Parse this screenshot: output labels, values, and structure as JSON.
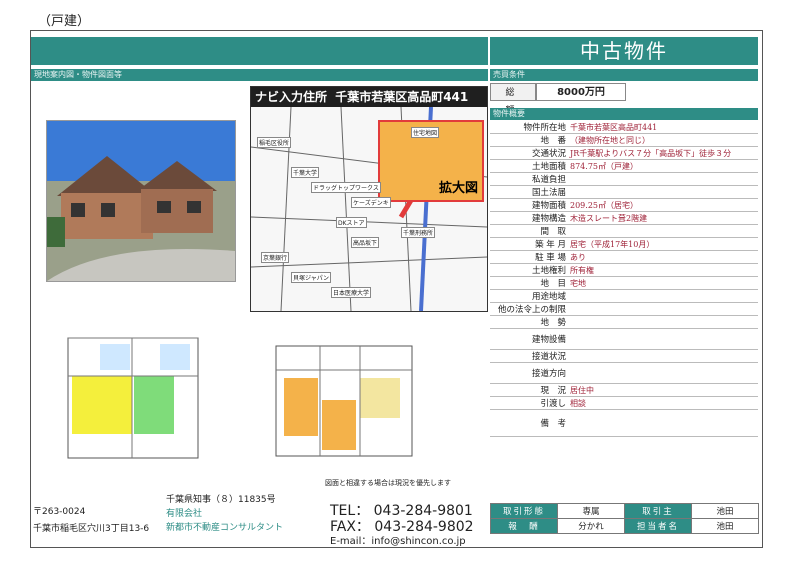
{
  "header": {
    "type_label": "（戸建）",
    "category_title": "中古物件",
    "left_section_label": "現地案内図・物件図面等",
    "sale_terms_label": "売買条件",
    "overview_label": "物件概要"
  },
  "price": {
    "label": "総　額",
    "value": "8000万円"
  },
  "details": [
    {
      "key": "物件所在地",
      "value": "千葉市若葉区高品町441"
    },
    {
      "key": "地　番",
      "value": "（建物所在地と同じ）"
    },
    {
      "key": "交通状況",
      "value": "JR千葉駅よりバス７分「高品坂下」徒歩３分"
    },
    {
      "key": "土地面積",
      "value": "874.75㎡（戸建）"
    },
    {
      "key": "私道負担",
      "value": ""
    },
    {
      "key": "国土法届",
      "value": ""
    },
    {
      "key": "建物面積",
      "value": "209.25㎡（居宅）"
    },
    {
      "key": "建物構造",
      "value": "木造スレート葺2階建"
    },
    {
      "key": "間　取",
      "value": ""
    },
    {
      "key": "築 年 月",
      "value": "居宅（平成17年10月）"
    },
    {
      "key": "駐 車 場",
      "value": "あり"
    },
    {
      "key": "土地権利",
      "value": "所有権"
    },
    {
      "key": "地　目",
      "value": "宅地"
    },
    {
      "key": "用途地域",
      "value": ""
    },
    {
      "key": "他の法令上の制限",
      "value": ""
    },
    {
      "key": "地　勢",
      "value": ""
    },
    {
      "key": "建物設備",
      "value": ""
    },
    {
      "key": "接道状況",
      "value": ""
    },
    {
      "key": "接道方向",
      "value": ""
    },
    {
      "key": "現　況",
      "value": "居住中"
    },
    {
      "key": "引渡し",
      "value": "相談"
    },
    {
      "key": "備　考",
      "value": ""
    }
  ],
  "map": {
    "header_prefix": "ナビ入力住所",
    "header_address": "千葉市若葉区高品町441",
    "zoom_label": "拡大図",
    "labels": [
      "稲毛区役所",
      "千葉大学",
      "ドラッグトップワークス",
      "ケーズデンキ",
      "DKストア",
      "千葉刑務所",
      "京葉銀行",
      "高品坂下",
      "住宅地図",
      "貝塚ジャパン",
      "日本医療大学"
    ]
  },
  "note": "図面と相違する場合は現況を優先します",
  "footer": {
    "postal": "〒263-0024",
    "address": "千葉市稲毛区穴川3丁目13-6",
    "license": "千葉県知事（８）11835号",
    "company_type": "有限会社",
    "company_name": "新都市不動産コンサルタント",
    "tel": "TEL： 043-284-9801",
    "fax": "FAX： 043-284-9802",
    "email": "E-mail：info@shincon.co.jp",
    "terms": [
      {
        "label": "取引形態",
        "value": "専属",
        "label2": "取引主",
        "value2": "池田"
      },
      {
        "label": "報　酬",
        "value": "分かれ",
        "label2": "担当者名",
        "value2": "池田"
      }
    ]
  },
  "colors": {
    "accent": "#2e8d86",
    "value_text": "#a0243a",
    "map_highlight": "#e23b3b"
  }
}
